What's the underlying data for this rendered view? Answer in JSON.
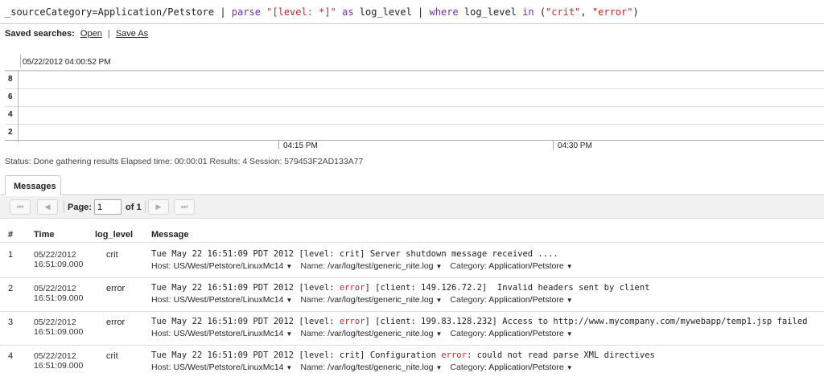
{
  "query": {
    "source": "_sourceCategory=Application/Petstore",
    "pipe1": "|",
    "parse_kw": "parse",
    "parse_pattern": "\"[level: *]\"",
    "as_kw": "as",
    "field": "log_level",
    "pipe2": "|",
    "where_kw": "where",
    "where_field": "log_level",
    "in_kw": "in",
    "in_open": "(",
    "val1": "\"crit\"",
    "comma": ",",
    "val2": "\"error\"",
    "in_close": ")"
  },
  "saved_searches": {
    "label": "Saved searches:",
    "open": "Open",
    "separator": "|",
    "save_as": "Save As"
  },
  "histogram": {
    "timestamp": "05/22/2012 04:00:52 PM",
    "y_ticks": [
      "8",
      "6",
      "4",
      "2"
    ],
    "x_ticks": [
      "04:15 PM",
      "04:30 PM"
    ]
  },
  "status": {
    "text": "Status: Done gathering results Elapsed time: 00:00:01 Results: 4 Session: 579453F2AD133A77"
  },
  "tabs": {
    "messages": "Messages"
  },
  "pager": {
    "first_icon": "first-page-icon",
    "prev_icon": "prev-page-icon",
    "next_icon": "next-page-icon",
    "last_icon": "last-page-icon",
    "first_glyph": "⏮",
    "prev_glyph": "◀",
    "next_glyph": "▶",
    "last_glyph": "⏭",
    "page_label": "Page:",
    "page_value": "1",
    "of_label": "of 1"
  },
  "table": {
    "headers": {
      "num": "#",
      "time": "Time",
      "level": "log_level",
      "message": "Message"
    },
    "meta_labels": {
      "host": "Host:",
      "name": "Name:",
      "category": "Category:"
    },
    "rows": [
      {
        "num": "1",
        "date": "05/22/2012",
        "time": "16:51:09.000",
        "level": "crit",
        "msg_a": "Tue May 22 16:51:09 PDT 2012 [level: crit] Server shutdown message received ....",
        "msg_hl": "",
        "msg_b": "",
        "host": "US/West/Petstore/LinuxMc14",
        "name": "/var/log/test/generic_nite.log",
        "category": "Application/Petstore"
      },
      {
        "num": "2",
        "date": "05/22/2012",
        "time": "16:51:09.000",
        "level": "error",
        "msg_a": "Tue May 22 16:51:09 PDT 2012 [level: ",
        "msg_hl": "error",
        "msg_b": "] [client: 149.126.72.2]  Invalid headers sent by client",
        "host": "US/West/Petstore/LinuxMc14",
        "name": "/var/log/test/generic_nite.log",
        "category": "Application/Petstore"
      },
      {
        "num": "3",
        "date": "05/22/2012",
        "time": "16:51:09.000",
        "level": "error",
        "msg_a": "Tue May 22 16:51:09 PDT 2012 [level: ",
        "msg_hl": "error",
        "msg_b": "] [client: 199.83.128.232] Access to http://www.mycompany.com/mywebapp/temp1.jsp failed",
        "host": "US/West/Petstore/LinuxMc14",
        "name": "/var/log/test/generic_nite.log",
        "category": "Application/Petstore"
      },
      {
        "num": "4",
        "date": "05/22/2012",
        "time": "16:51:09.000",
        "level": "crit",
        "msg_a": "Tue May 22 16:51:09 PDT 2012 [level: crit] Configuration ",
        "msg_hl": "error",
        "msg_b": ": could not read parse XML directives",
        "host": "US/West/Petstore/LinuxMc14",
        "name": "/var/log/test/generic_nite.log",
        "category": "Application/Petstore"
      }
    ]
  },
  "colors": {
    "keyword": "#6f2fa5",
    "string": "#c52828",
    "error_highlight": "#c52828"
  }
}
